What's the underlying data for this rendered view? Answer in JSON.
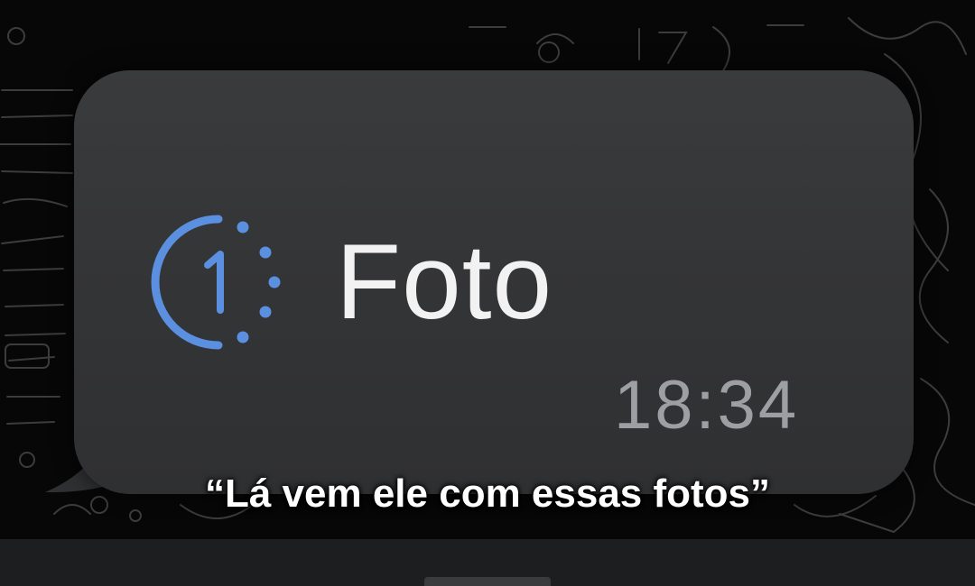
{
  "message": {
    "text": "Foto",
    "time": "18:34",
    "icon": "view-once-icon",
    "icon_digit": "1"
  },
  "caption": {
    "text": "“Lá vem ele com essas fotos”"
  },
  "colors": {
    "background": "#070707",
    "bubble": "#363739",
    "icon_accent": "#5b8fe0",
    "message_text": "#f2f2f2",
    "timestamp": "#9d9fa3",
    "caption_text": "#ffffff"
  }
}
